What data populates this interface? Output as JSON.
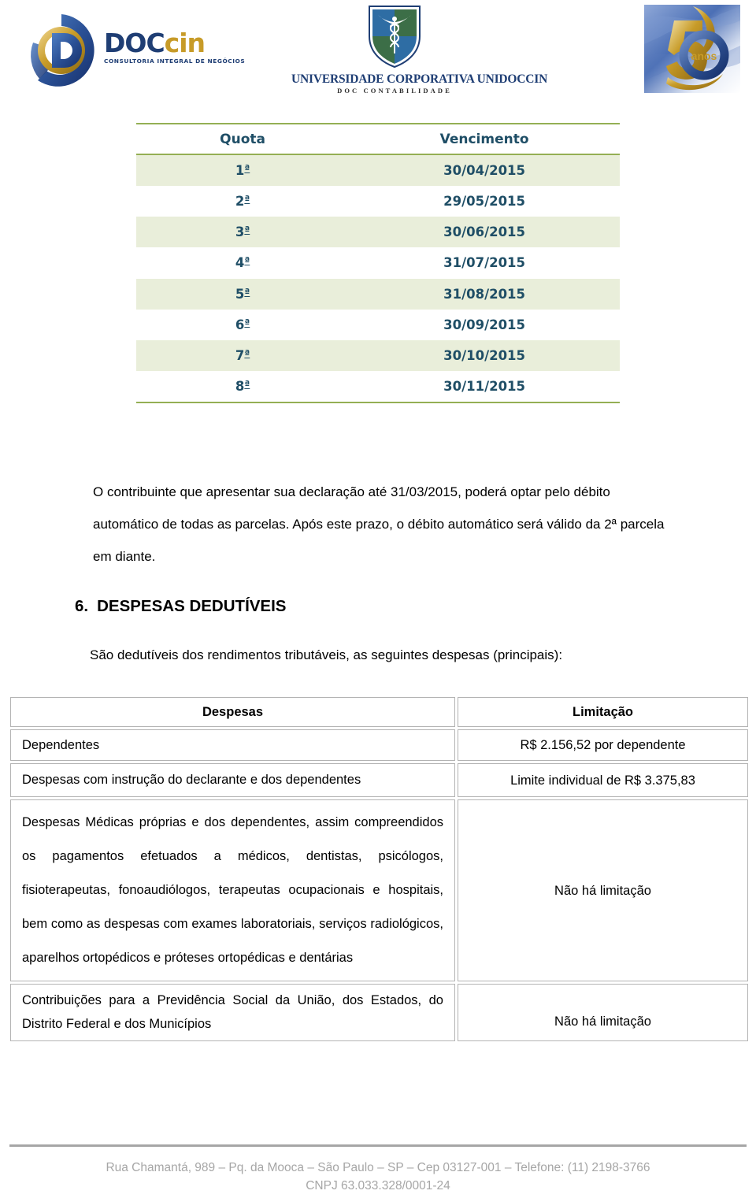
{
  "header": {
    "logos": [
      {
        "name": "doccin",
        "word_part1": "DOC",
        "word_part2": "cin",
        "tagline": "CONSULTORIA INTEGRAL DE NEGÓCIOS",
        "colors": {
          "blue": "#1F3E74",
          "gold": "#C79B28"
        }
      },
      {
        "name": "unidoccin",
        "line1": "UNIVERSIDADE CORPORATIVA UNIDOCCIN",
        "line2": "DOC CONTABILIDADE",
        "colors": {
          "shield_blue": "#2E6DA4",
          "shield_green": "#3C6E47",
          "text_blue": "#1F3E74"
        }
      },
      {
        "name": "50-anos",
        "number": "50",
        "label": "anos",
        "colors": {
          "gold": "#C79B28",
          "blue": "#2B4C8C"
        }
      }
    ]
  },
  "quota_table": {
    "headers": {
      "quota": "Quota",
      "vencimento": "Vencimento"
    },
    "rows": [
      {
        "quota_num": "1",
        "quota_ord": "ª",
        "vencimento": "30/04/2015"
      },
      {
        "quota_num": "2",
        "quota_ord": "ª",
        "vencimento": "29/05/2015"
      },
      {
        "quota_num": "3",
        "quota_ord": "ª",
        "vencimento": "30/06/2015"
      },
      {
        "quota_num": "4",
        "quota_ord": "ª",
        "vencimento": "31/07/2015"
      },
      {
        "quota_num": "5",
        "quota_ord": "ª",
        "vencimento": "31/08/2015"
      },
      {
        "quota_num": "6",
        "quota_ord": "ª",
        "vencimento": "30/09/2015"
      },
      {
        "quota_num": "7",
        "quota_ord": "ª",
        "vencimento": "30/10/2015"
      },
      {
        "quota_num": "8",
        "quota_ord": "ª",
        "vencimento": "30/11/2015"
      }
    ],
    "colors": {
      "rule": "#94AF54",
      "stripe": "#E9EEDA",
      "text": "#1F4E66"
    }
  },
  "body": {
    "paragraph_debito": "O contribuinte que apresentar sua declaração até 31/03/2015, poderá optar pelo débito automático de todas as parcelas. Após este prazo, o débito automático será válido da 2ª parcela em diante.",
    "section_number": "6.",
    "section_title": "DESPESAS DEDUTÍVEIS",
    "section_intro": "São dedutíveis dos rendimentos tributáveis, as seguintes despesas (principais):"
  },
  "despesas_table": {
    "headers": {
      "despesas": "Despesas",
      "limitacao": "Limitação"
    },
    "rows": [
      {
        "despesa": "Dependentes",
        "limitacao": "R$ 2.156,52 por dependente"
      },
      {
        "despesa": "Despesas com instrução do declarante e dos dependentes",
        "limitacao": "Limite individual de R$ 3.375,83"
      },
      {
        "despesa": "Despesas Médicas próprias e dos dependentes, assim compreendidos os pagamentos efetuados a médicos, dentistas, psicólogos, fisioterapeutas, fonoaudiólogos, terapeutas ocupacionais e hospitais, bem como as despesas com exames laboratoriais, serviços radiológicos, aparelhos ortopédicos e próteses ortopédicas e dentárias",
        "limitacao": "Não há limitação"
      },
      {
        "despesa": "Contribuições para a Previdência Social da União, dos Estados, do Distrito Federal e dos Municípios",
        "limitacao": "Não há limitação"
      }
    ],
    "colors": {
      "border": "#B3B3B3"
    }
  },
  "footer": {
    "line1": "Rua Chamantá, 989 – Pq. da Mooca – São Paulo – SP – Cep 03127-001 – Telefone: (11) 2198-3766",
    "line2": "CNPJ 63.033.328/0001-24",
    "color": "#A6A6A6"
  }
}
